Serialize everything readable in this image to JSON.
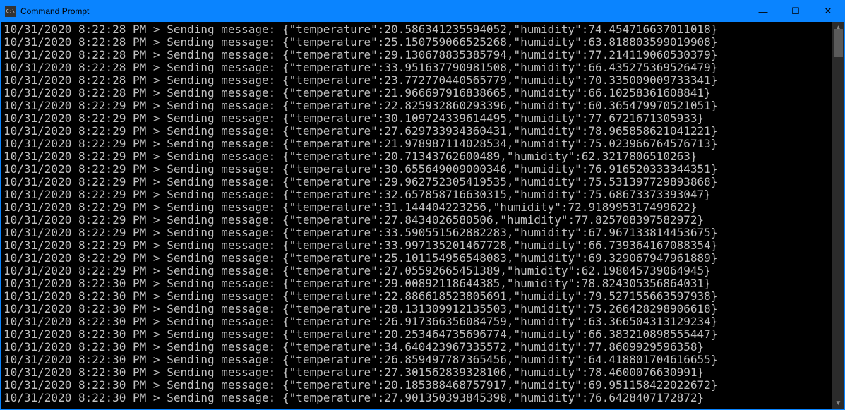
{
  "window": {
    "title": "Command Prompt",
    "icon_text": "C:\\"
  },
  "log": {
    "prefix": "Sending message:",
    "entries": [
      {
        "ts": "10/31/2020 8:22:28 PM",
        "temperature": "20.586341235594052",
        "humidity": "74.454716637011018"
      },
      {
        "ts": "10/31/2020 8:22:28 PM",
        "temperature": "25.150759066525268",
        "humidity": "63.818803599019908"
      },
      {
        "ts": "10/31/2020 8:22:28 PM",
        "temperature": "29.130678835385794",
        "humidity": "77.214119060530379"
      },
      {
        "ts": "10/31/2020 8:22:28 PM",
        "temperature": "33.951637790981508",
        "humidity": "66.435275369526479"
      },
      {
        "ts": "10/31/2020 8:22:28 PM",
        "temperature": "23.772770440565779",
        "humidity": "70.335009009733341"
      },
      {
        "ts": "10/31/2020 8:22:28 PM",
        "temperature": "21.966697916838665",
        "humidity": "66.10258361608841"
      },
      {
        "ts": "10/31/2020 8:22:29 PM",
        "temperature": "22.825932860293396",
        "humidity": "60.365479970521051"
      },
      {
        "ts": "10/31/2020 8:22:29 PM",
        "temperature": "30.109724339614495",
        "humidity": "77.6721671305933"
      },
      {
        "ts": "10/31/2020 8:22:29 PM",
        "temperature": "27.629733934360431",
        "humidity": "78.965858621041221"
      },
      {
        "ts": "10/31/2020 8:22:29 PM",
        "temperature": "21.978987114028534",
        "humidity": "75.023966764576713"
      },
      {
        "ts": "10/31/2020 8:22:29 PM",
        "temperature": "20.71343762600489",
        "humidity": "62.3217806510263"
      },
      {
        "ts": "10/31/2020 8:22:29 PM",
        "temperature": "30.655649009000346",
        "humidity": "76.916520333344351"
      },
      {
        "ts": "10/31/2020 8:22:29 PM",
        "temperature": "29.962752305419535",
        "humidity": "75.531397729893868"
      },
      {
        "ts": "10/31/2020 8:22:29 PM",
        "temperature": "32.657858716630315",
        "humidity": "75.68673373393047"
      },
      {
        "ts": "10/31/2020 8:22:29 PM",
        "temperature": "31.144404223256",
        "humidity": "72.918995317499622"
      },
      {
        "ts": "10/31/2020 8:22:29 PM",
        "temperature": "27.8434026580506",
        "humidity": "77.825708397582972"
      },
      {
        "ts": "10/31/2020 8:22:29 PM",
        "temperature": "33.590551562882283",
        "humidity": "67.967133814453675"
      },
      {
        "ts": "10/31/2020 8:22:29 PM",
        "temperature": "33.997135201467728",
        "humidity": "66.739364167088354"
      },
      {
        "ts": "10/31/2020 8:22:29 PM",
        "temperature": "25.101154956548083",
        "humidity": "69.329067947961889"
      },
      {
        "ts": "10/31/2020 8:22:29 PM",
        "temperature": "27.05592665451389",
        "humidity": "62.198045739064945"
      },
      {
        "ts": "10/31/2020 8:22:30 PM",
        "temperature": "29.00892118644385",
        "humidity": "78.824305356864031"
      },
      {
        "ts": "10/31/2020 8:22:30 PM",
        "temperature": "22.886618523805691",
        "humidity": "79.527155663597938"
      },
      {
        "ts": "10/31/2020 8:22:30 PM",
        "temperature": "28.131309912135503",
        "humidity": "75.266428298906618"
      },
      {
        "ts": "10/31/2020 8:22:30 PM",
        "temperature": "26.917366356084759",
        "humidity": "63.366504313129234"
      },
      {
        "ts": "10/31/2020 8:22:30 PM",
        "temperature": "20.253464735696774",
        "humidity": "66.383210898555447"
      },
      {
        "ts": "10/31/2020 8:22:30 PM",
        "temperature": "34.640423967335572",
        "humidity": "77.8609929596358"
      },
      {
        "ts": "10/31/2020 8:22:30 PM",
        "temperature": "26.859497787365456",
        "humidity": "64.418801704616655"
      },
      {
        "ts": "10/31/2020 8:22:30 PM",
        "temperature": "27.301562839328106",
        "humidity": "78.4600076630991"
      },
      {
        "ts": "10/31/2020 8:22:30 PM",
        "temperature": "20.185388468757917",
        "humidity": "69.951158422022672"
      },
      {
        "ts": "10/31/2020 8:22:30 PM",
        "temperature": "27.901350393845398",
        "humidity": "76.6428407172872"
      }
    ]
  }
}
